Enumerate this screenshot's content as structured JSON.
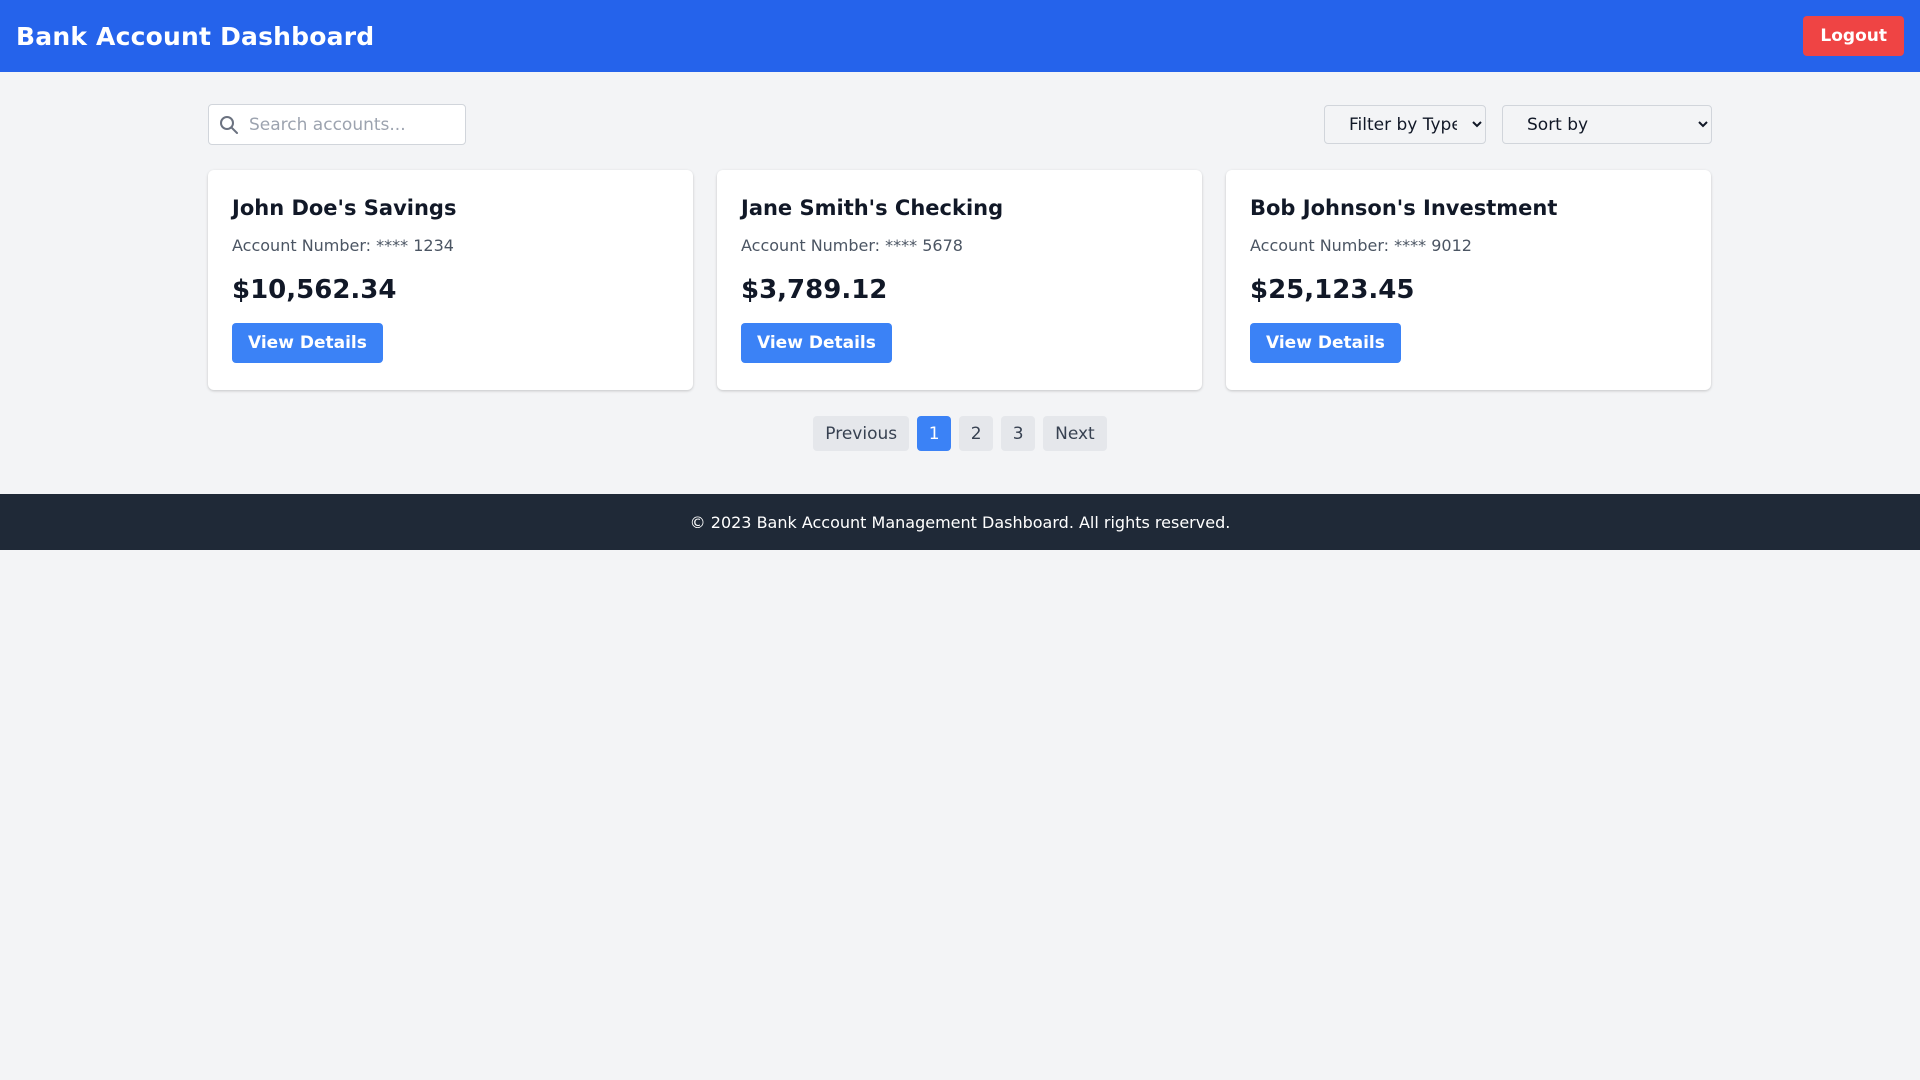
{
  "header": {
    "title": "Bank Account Dashboard",
    "logout_label": "Logout"
  },
  "controls": {
    "search_placeholder": "Search accounts...",
    "filter_selected": "Filter by Type",
    "sort_selected": "Sort by"
  },
  "accounts": [
    {
      "name": "John Doe's Savings",
      "account_number": "Account Number: **** 1234",
      "balance": "$10,562.34",
      "button_label": "View Details"
    },
    {
      "name": "Jane Smith's Checking",
      "account_number": "Account Number: **** 5678",
      "balance": "$3,789.12",
      "button_label": "View Details"
    },
    {
      "name": "Bob Johnson's Investment",
      "account_number": "Account Number: **** 9012",
      "balance": "$25,123.45",
      "button_label": "View Details"
    }
  ],
  "pagination": {
    "previous_label": "Previous",
    "pages": [
      "1",
      "2",
      "3"
    ],
    "current_page": "1",
    "next_label": "Next"
  },
  "footer": {
    "text": "© 2023 Bank Account Management Dashboard. All rights reserved."
  },
  "colors": {
    "header_bg": "#2563eb",
    "logout_bg": "#ef4444",
    "primary_button": "#3b82f6",
    "footer_bg": "#1f2937",
    "page_bg": "#f3f4f6"
  },
  "icons": {
    "search": "search-icon"
  }
}
